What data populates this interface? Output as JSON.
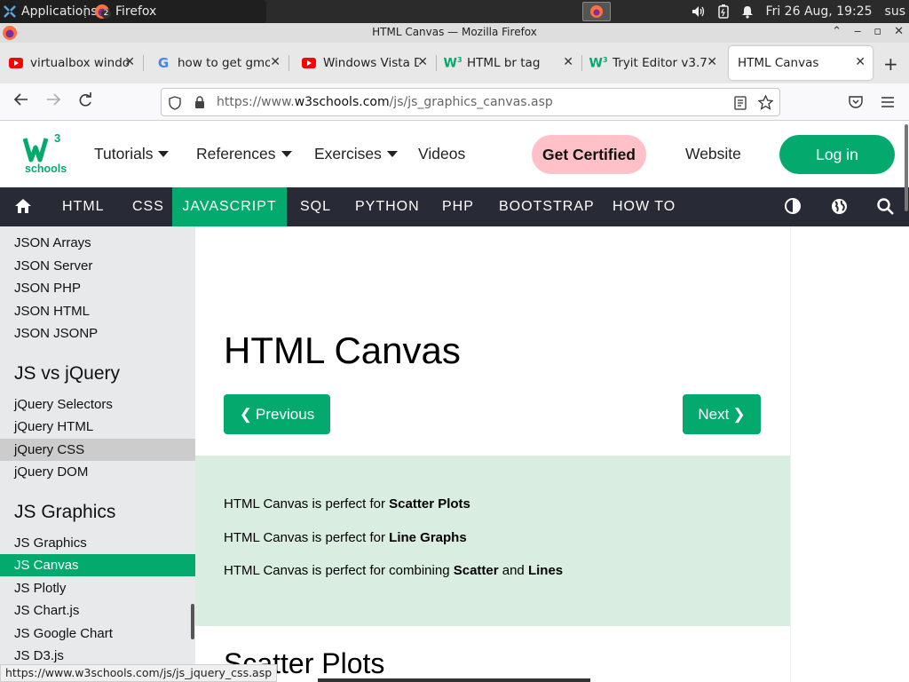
{
  "taskbar": {
    "applications_label": "Applications",
    "firefox_label": "Firefox",
    "firefox_badge": "2",
    "clock": "Fri 26 Aug, 19:25",
    "user": "sus"
  },
  "window": {
    "title": "HTML Canvas — Mozilla Firefox"
  },
  "tabs": [
    {
      "label": "virtualbox window",
      "icon": "youtube-icon"
    },
    {
      "label": "how to get gmod f",
      "icon": "google-icon"
    },
    {
      "label": "Windows Vista Di",
      "icon": "youtube-icon"
    },
    {
      "label": "HTML br tag",
      "icon": "w3schools-icon"
    },
    {
      "label": "Tryit Editor v3.7",
      "icon": "w3schools-icon"
    },
    {
      "label": "HTML Canvas",
      "icon": "none",
      "active": true
    }
  ],
  "urlbar": {
    "url_prefix": "https://www.",
    "url_domain": "w3schools.com",
    "url_path": "/js/js_graphics_canvas.asp"
  },
  "header": {
    "logo_text": "schools",
    "logo_w": "W",
    "logo_sup": "3",
    "menus": [
      "Tutorials",
      "References",
      "Exercises"
    ],
    "videos": "Videos",
    "get_certified": "Get Certified",
    "website": "Website",
    "login": "Log in"
  },
  "topnav": {
    "items": [
      "HTML",
      "CSS",
      "JAVASCRIPT",
      "SQL",
      "PYTHON",
      "PHP",
      "BOOTSTRAP",
      "HOW TO"
    ],
    "active": "JAVASCRIPT",
    "active_color": "#04aa6d"
  },
  "sidebar": {
    "json_items": [
      "JSON Arrays",
      "JSON Server",
      "JSON PHP",
      "JSON HTML",
      "JSON JSONP"
    ],
    "heading_jquery": "JS vs jQuery",
    "jquery_items": [
      "jQuery Selectors",
      "jQuery HTML",
      "jQuery CSS",
      "jQuery DOM"
    ],
    "heading_graphics": "JS Graphics",
    "graphics_items": [
      "JS Graphics",
      "JS Canvas",
      "JS Plotly",
      "JS Chart.js",
      "JS Google Chart",
      "JS D3.js"
    ],
    "hovered_item": "jQuery CSS",
    "active_item": "JS Canvas"
  },
  "main": {
    "title": "HTML Canvas",
    "prev_label": "Previous",
    "next_label": "Next",
    "note": [
      {
        "prefix": "HTML Canvas is perfect for ",
        "bold1": "Scatter Plots",
        "mid": "",
        "bold2": ""
      },
      {
        "prefix": "HTML Canvas is perfect for ",
        "bold1": "Line Graphs",
        "mid": "",
        "bold2": ""
      },
      {
        "prefix": "HTML Canvas is perfect for combining ",
        "bold1": "Scatter",
        "mid": " and ",
        "bold2": "Lines"
      }
    ],
    "section_heading": "Scatter Plots"
  },
  "statusbar": {
    "url": "https://www.w3schools.com/js/js_jquery_css.asp"
  },
  "colors": {
    "brand_green": "#04aa6d",
    "topnav_bg": "#282a35",
    "note_bg": "#d9eee1",
    "cert_pink": "#ffc0c7",
    "sidebar_bg": "#e7e9eb"
  }
}
